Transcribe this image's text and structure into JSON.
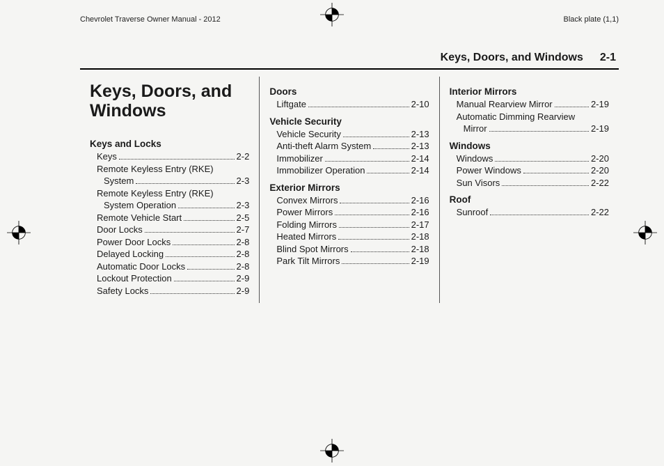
{
  "meta": {
    "left_header": "Chevrolet Traverse Owner Manual - 2012",
    "right_header": "Black plate (1,1)"
  },
  "header": {
    "title": "Keys, Doors, and Windows",
    "page": "2-1"
  },
  "chapter_title": "Keys, Doors, and Windows",
  "col1": {
    "sections": [
      {
        "title": "Keys and Locks",
        "entries": [
          {
            "label": "Keys",
            "page": "2-2"
          },
          {
            "label": "Remote Keyless Entry (RKE) System",
            "page": "2-3",
            "wrap": true
          },
          {
            "label": "Remote Keyless Entry (RKE) System Operation",
            "page": "2-3",
            "wrap": true
          },
          {
            "label": "Remote Vehicle Start",
            "page": "2-5"
          },
          {
            "label": "Door Locks",
            "page": "2-7"
          },
          {
            "label": "Power Door Locks",
            "page": "2-8"
          },
          {
            "label": "Delayed Locking",
            "page": "2-8"
          },
          {
            "label": "Automatic Door Locks",
            "page": "2-8"
          },
          {
            "label": "Lockout Protection",
            "page": "2-9"
          },
          {
            "label": "Safety Locks",
            "page": "2-9"
          }
        ]
      }
    ]
  },
  "col2": {
    "sections": [
      {
        "title": "Doors",
        "entries": [
          {
            "label": "Liftgate",
            "page": "2-10"
          }
        ]
      },
      {
        "title": "Vehicle Security",
        "entries": [
          {
            "label": "Vehicle Security",
            "page": "2-13"
          },
          {
            "label": "Anti-theft Alarm System",
            "page": "2-13"
          },
          {
            "label": "Immobilizer",
            "page": "2-14"
          },
          {
            "label": "Immobilizer Operation",
            "page": "2-14"
          }
        ]
      },
      {
        "title": "Exterior Mirrors",
        "entries": [
          {
            "label": "Convex Mirrors",
            "page": "2-16"
          },
          {
            "label": "Power Mirrors",
            "page": "2-16"
          },
          {
            "label": "Folding Mirrors",
            "page": "2-17"
          },
          {
            "label": "Heated Mirrors",
            "page": "2-18"
          },
          {
            "label": "Blind Spot Mirrors",
            "page": "2-18"
          },
          {
            "label": "Park Tilt Mirrors",
            "page": "2-19"
          }
        ]
      }
    ]
  },
  "col3": {
    "sections": [
      {
        "title": "Interior Mirrors",
        "entries": [
          {
            "label": "Manual Rearview Mirror",
            "page": "2-19"
          },
          {
            "label": "Automatic Dimming Rearview Mirror",
            "page": "2-19",
            "wrap": true
          }
        ]
      },
      {
        "title": "Windows",
        "entries": [
          {
            "label": "Windows",
            "page": "2-20"
          },
          {
            "label": "Power Windows",
            "page": "2-20"
          },
          {
            "label": "Sun Visors",
            "page": "2-22"
          }
        ]
      },
      {
        "title": "Roof",
        "entries": [
          {
            "label": "Sunroof",
            "page": "2-22"
          }
        ]
      }
    ]
  }
}
